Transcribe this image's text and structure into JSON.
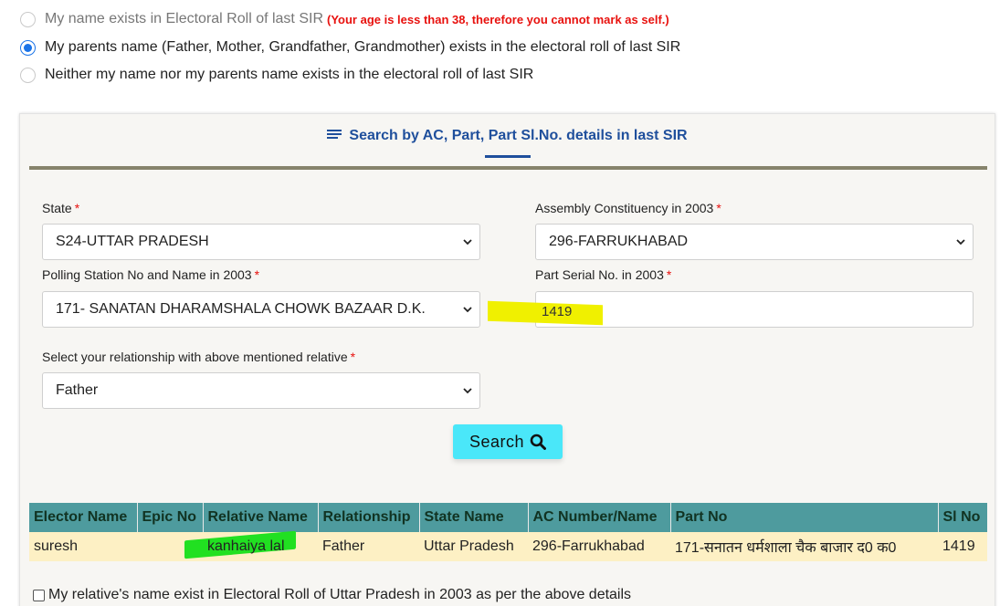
{
  "options": {
    "own_name": {
      "label": "My name exists in Electoral Roll of last SIR",
      "warning": "(Your age is less than 38, therefore you cannot mark as self.)",
      "selected": false,
      "disabled": true
    },
    "parents_name": {
      "label": "My parents name (Father, Mother, Grandfather, Grandmother) exists in the electoral roll of last SIR",
      "selected": true
    },
    "neither": {
      "label": "Neither my name nor my parents name exists in the electoral roll of last SIR",
      "selected": false
    }
  },
  "search_tab": {
    "title": "Search by AC, Part, Part Sl.No. details in last SIR",
    "icon": "menu-lines-icon"
  },
  "form": {
    "state": {
      "label": "State",
      "required": "*",
      "value": "S24-UTTAR PRADESH"
    },
    "assembly": {
      "label": "Assembly Constituency in 2003",
      "required": "*",
      "value": "296-FARRUKHABAD"
    },
    "polling_station": {
      "label": "Polling Station No and Name in 2003",
      "required": "*",
      "value": "171- SANATAN DHARAMSHALA CHOWK BAZAAR D.K."
    },
    "part_serial": {
      "label": "Part Serial No. in 2003",
      "required": "*",
      "value": "1419"
    },
    "relationship": {
      "label": "Select your relationship with above mentioned relative",
      "required": "*",
      "value": "Father"
    },
    "search_button": "Search",
    "search_icon": "magnifier-icon"
  },
  "results": {
    "headers": [
      "Elector Name",
      "Epic No",
      "Relative Name",
      "Relationship",
      "State Name",
      "AC Number/Name",
      "Part No",
      "Sl No"
    ],
    "rows": [
      {
        "elector_name": "suresh",
        "epic_no": "",
        "relative_name": "kanhaiya lal",
        "relationship": "Father",
        "state_name": "Uttar Pradesh",
        "ac": "296-Farrukhabad",
        "part_no": "171-सनातन धर्मशाला चैक बाजार द0 क0",
        "sl_no": "1419"
      }
    ]
  },
  "confirm": {
    "label": "My relative's name exist in Electoral Roll of Uttar Pradesh in 2003 as per the above details",
    "checked": false
  },
  "colors": {
    "accent_blue": "#1f4f9c",
    "radio_blue": "#1a73e8",
    "required_red": "#e8110e",
    "search_button": "#4ae7f9",
    "table_header": "#4e9b9e",
    "table_row": "#fdf0c4",
    "highlight_yellow": "#f0f000",
    "highlight_green": "#21e021"
  }
}
